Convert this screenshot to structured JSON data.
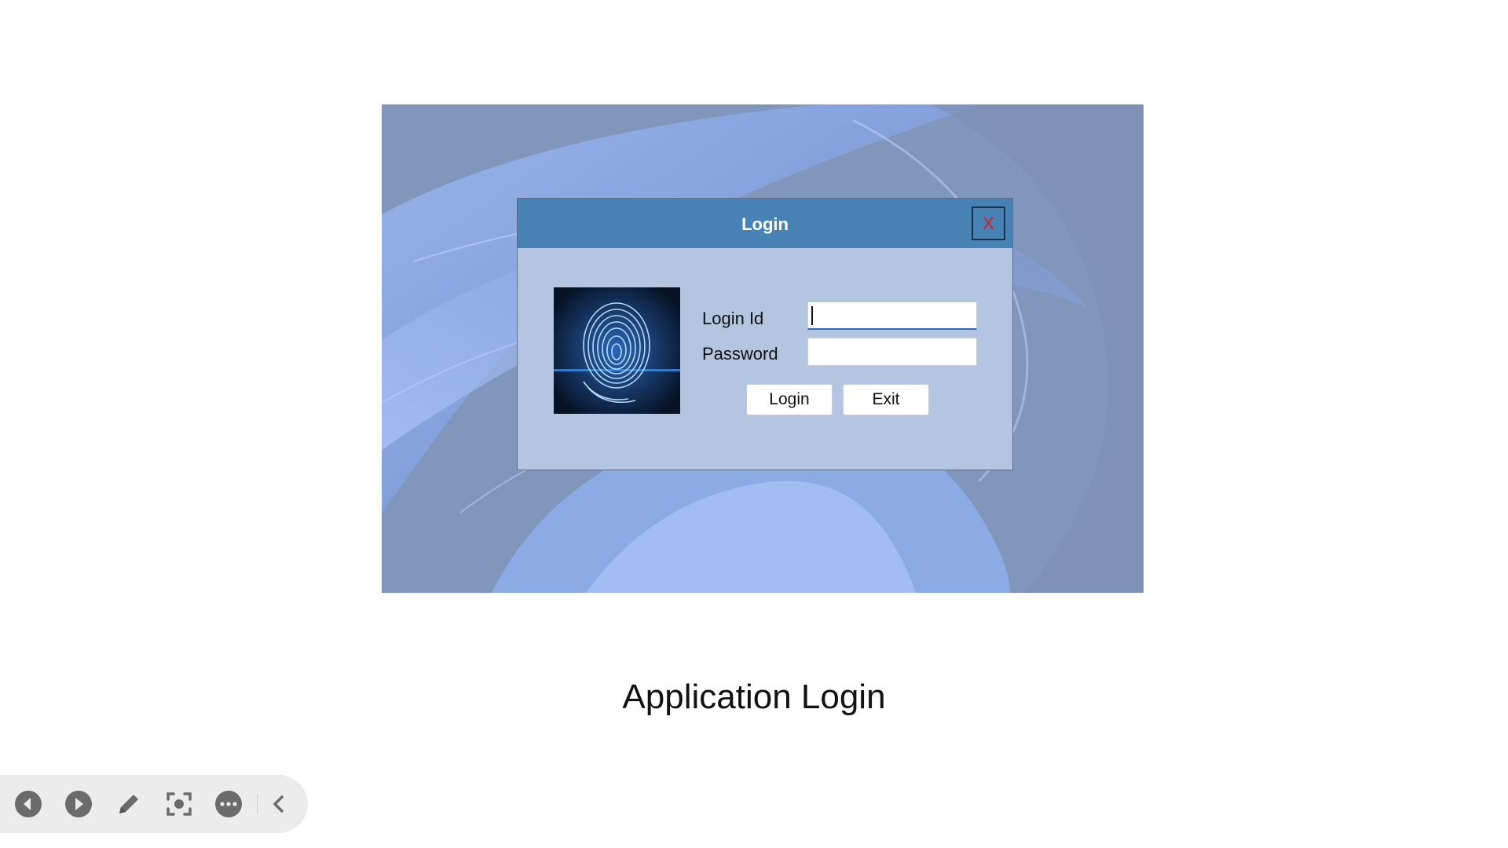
{
  "dialog": {
    "title": "Login",
    "close_label": "X",
    "login_id_label": "Login Id",
    "password_label": "Password",
    "login_id_value": "",
    "password_value": "",
    "login_button": "Login",
    "exit_button": "Exit"
  },
  "caption": "Application Login",
  "toolbar": {
    "icons": [
      "previous-icon",
      "next-icon",
      "pen-icon",
      "focus-icon",
      "more-icon",
      "collapse-icon"
    ]
  },
  "colors": {
    "titlebar": "#4682b4",
    "dialog_body": "#b3c5e0",
    "close_x": "#e01818",
    "toolbar_icon": "#6b6b6b"
  }
}
